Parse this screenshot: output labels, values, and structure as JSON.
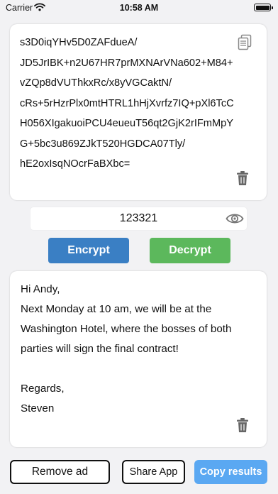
{
  "status_bar": {
    "carrier": "Carrier",
    "time": "10:58 AM"
  },
  "cipher": {
    "text": "s3D0iqYHv5D0ZAFdueA/\nJD5JrIBK+n2U67HR7prMXNArVNa602+M84+\nvZQp8dVUThkxRc/x8yVGCaktN/\ncRs+5rHzrPlx0mtHTRL1hHjXvrfz7IQ+pXl6TcC\nH056XIgakuoiPCU4eueuT56qt2GjK2rIFmMpY\nG+5bc3u869ZJkT520HGDCA07Tly/\nhE2oxIsqNOcrFaBXbc="
  },
  "key": {
    "value": "123321"
  },
  "actions": {
    "encrypt": "Encrypt",
    "decrypt": "Decrypt"
  },
  "message": {
    "text": "Hi Andy,\nNext Monday at 10 am, we will be at the Washington Hotel, where the bosses of both parties will sign the final contract!\n\nRegards,\nSteven"
  },
  "bottom_bar": {
    "remove_ad": "Remove ad",
    "share_app": "Share App",
    "copy_results": "Copy results"
  },
  "colors": {
    "encrypt": "#3a7fc4",
    "decrypt": "#5cb85c",
    "copy_results": "#5aa8f2",
    "background": "#f2f2f4"
  },
  "icons": [
    "wifi-icon",
    "battery-icon",
    "copy-icon",
    "trash-icon",
    "eye-icon"
  ]
}
